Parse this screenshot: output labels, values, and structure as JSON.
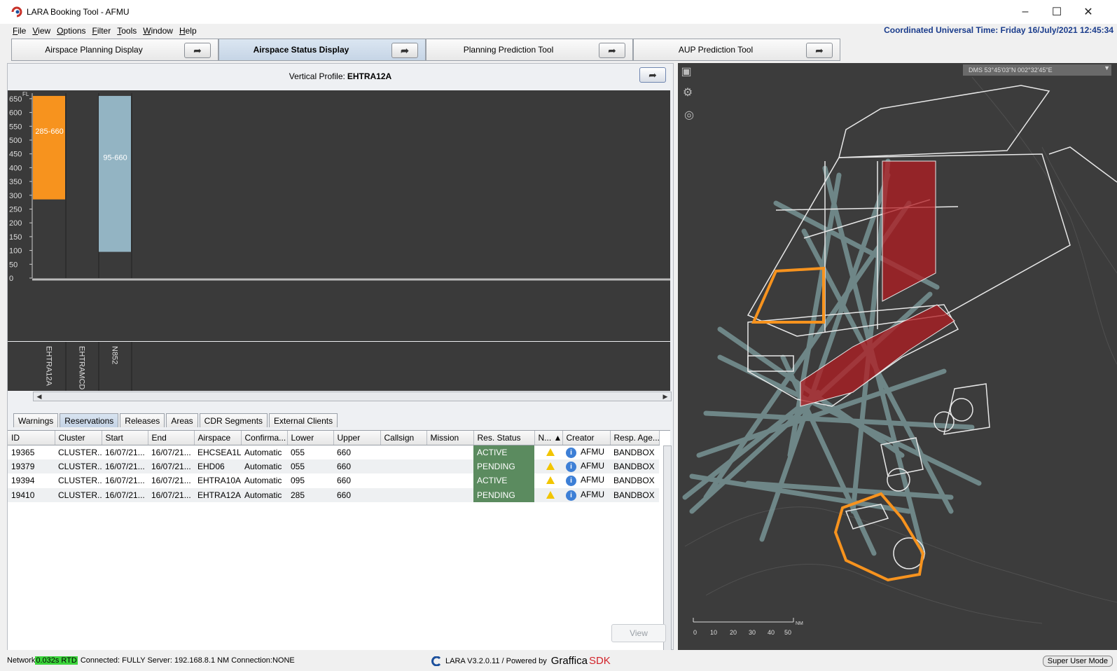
{
  "window": {
    "title": "LARA Booking Tool - AFMU",
    "minimize": "–",
    "maximize": "☐",
    "close": "✕"
  },
  "menu": [
    "File",
    "View",
    "Options",
    "Filter",
    "Tools",
    "Window",
    "Help"
  ],
  "utc_label": "Coordinated Universal Time: Friday 16/July/2021  12:45:34",
  "main_tabs": [
    {
      "label": "Airspace Planning Display"
    },
    {
      "label": "Airspace Status Display"
    },
    {
      "label": "Planning Prediction Tool"
    },
    {
      "label": "AUP Prediction Tool"
    }
  ],
  "vertical_profile": {
    "label": "Vertical Profile:",
    "name": "EHTRA12A"
  },
  "chart_data": {
    "type": "bar",
    "y_axis_label": "FL",
    "y_ticks": [
      0,
      50,
      100,
      150,
      200,
      250,
      300,
      350,
      400,
      450,
      500,
      550,
      600,
      650
    ],
    "ylim": [
      0,
      670
    ],
    "categories": [
      "EHTRA12A",
      "EHTRAMCD",
      "N852"
    ],
    "bars": [
      {
        "category": "EHTRA12A",
        "lower": 285,
        "upper": 660,
        "label": "285-660",
        "color": "#f7931e"
      },
      {
        "category": "EHTRAMCD",
        "lower": null,
        "upper": null,
        "label": "",
        "color": "#3a3a3a"
      },
      {
        "category": "N852",
        "lower": 95,
        "upper": 660,
        "label": "95-660",
        "color": "#93b4c3"
      }
    ]
  },
  "sub_tabs": [
    "Warnings",
    "Reservations",
    "Releases",
    "Areas",
    "CDR Segments",
    "External Clients"
  ],
  "table": {
    "columns": [
      "ID",
      "Cluster",
      "Start",
      "End",
      "Airspace",
      "Confirma...",
      "Lower",
      "Upper",
      "Callsign",
      "Mission",
      "Res. Status",
      "N...  ▲",
      "Creator",
      "Resp. Age..."
    ],
    "rows": [
      [
        "19365",
        "CLUSTER...",
        "16/07/21...",
        "16/07/21...",
        "EHCSEA1L",
        "Automatic",
        "055",
        "660",
        "",
        "",
        "ACTIVE",
        "",
        "AFMU",
        "BANDBOX"
      ],
      [
        "19379",
        "CLUSTER...",
        "16/07/21...",
        "16/07/21...",
        "EHD06",
        "Automatic",
        "055",
        "660",
        "",
        "",
        "PENDING",
        "",
        "AFMU",
        "BANDBOX"
      ],
      [
        "19394",
        "CLUSTER...",
        "16/07/21...",
        "16/07/21...",
        "EHTRA10A",
        "Automatic",
        "095",
        "660",
        "",
        "",
        "ACTIVE",
        "",
        "AFMU",
        "BANDBOX"
      ],
      [
        "19410",
        "CLUSTER...",
        "16/07/21...",
        "16/07/21...",
        "EHTRA12A",
        "Automatic",
        "285",
        "660",
        "",
        "",
        "PENDING",
        "",
        "AFMU",
        "BANDBOX"
      ]
    ]
  },
  "view_button": "View",
  "map": {
    "coord_text": "DMS    53°45'03\"N  002°32'45\"E",
    "scale_ticks": [
      "0",
      "10",
      "20",
      "30",
      "40",
      "50"
    ],
    "scale_unit": "NM"
  },
  "status": {
    "network": "Network",
    "rtd": "0.032s RTD",
    "info": "Connected: FULLY Server: 192.168.8.1 NM Connection:NONE",
    "version": "LARA V3.2.0.11  /  Powered by",
    "graffica": "Graffica",
    "sdk": "SDK",
    "mode": "Super User Mode"
  }
}
